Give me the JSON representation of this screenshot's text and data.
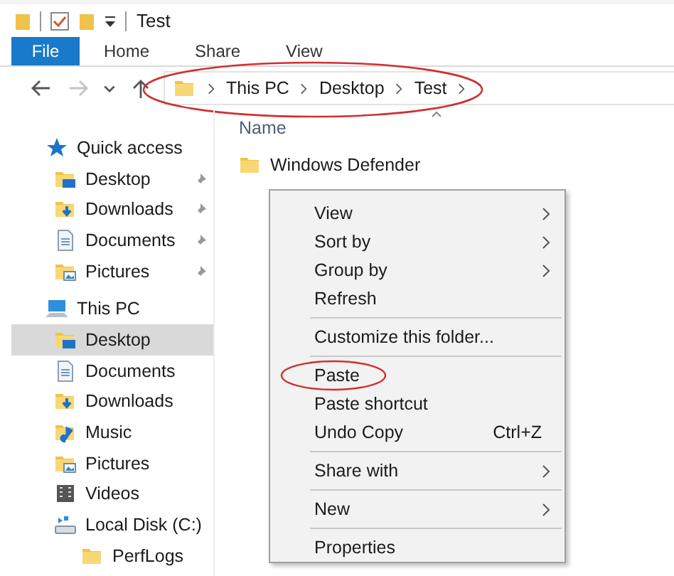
{
  "window": {
    "title": "Test"
  },
  "ribbon_tabs": [
    {
      "label": "File",
      "kind": "file"
    },
    {
      "label": "Home",
      "kind": "tab"
    },
    {
      "label": "Share",
      "kind": "tab"
    },
    {
      "label": "View",
      "kind": "tab"
    }
  ],
  "nav_buttons": [
    {
      "kind": "back",
      "disabled": false
    },
    {
      "kind": "forward",
      "disabled": true
    },
    {
      "kind": "recent",
      "disabled": false
    },
    {
      "kind": "up",
      "disabled": false
    }
  ],
  "address_bar": {
    "circled": true,
    "crumbs": [
      "This PC",
      "Desktop",
      "Test"
    ]
  },
  "sidebar": {
    "items": [
      {
        "label": "Quick access",
        "kind": "star",
        "selected": false,
        "children": [
          {
            "label": "Desktop",
            "kind": "desktop",
            "pinned": true,
            "selected": false
          },
          {
            "label": "Downloads",
            "kind": "downloads",
            "pinned": true,
            "selected": false
          },
          {
            "label": "Documents",
            "kind": "documents",
            "pinned": true,
            "selected": false
          },
          {
            "label": "Pictures",
            "kind": "pictures",
            "pinned": true,
            "selected": false
          }
        ]
      },
      {
        "label": "This PC",
        "kind": "pc",
        "selected": false,
        "children": [
          {
            "label": "Desktop",
            "kind": "desktop",
            "pinned": false,
            "selected": true
          },
          {
            "label": "Documents",
            "kind": "documents",
            "pinned": false,
            "selected": false
          },
          {
            "label": "Downloads",
            "kind": "downloads",
            "pinned": false,
            "selected": false
          },
          {
            "label": "Music",
            "kind": "music",
            "pinned": false,
            "selected": false
          },
          {
            "label": "Pictures",
            "kind": "pictures",
            "pinned": false,
            "selected": false
          },
          {
            "label": "Videos",
            "kind": "videos",
            "pinned": false,
            "selected": false
          },
          {
            "label": "Local Disk (C:)",
            "kind": "disk",
            "pinned": false,
            "selected": false,
            "children": [
              {
                "label": "PerfLogs",
                "kind": "folder",
                "pinned": false,
                "selected": false
              }
            ]
          }
        ]
      }
    ]
  },
  "file_list": {
    "columns": [
      "Name"
    ],
    "rows": [
      "Windows Defender"
    ]
  },
  "context_menu": {
    "groups": [
      [
        {
          "label": "View",
          "submenu": true,
          "circled": false
        },
        {
          "label": "Sort by",
          "submenu": true,
          "circled": false
        },
        {
          "label": "Group by",
          "submenu": true,
          "circled": false
        },
        {
          "label": "Refresh",
          "submenu": false,
          "circled": false
        }
      ],
      [
        {
          "label": "Customize this folder...",
          "submenu": false,
          "circled": false
        }
      ],
      [
        {
          "label": "Paste",
          "submenu": false,
          "circled": true
        },
        {
          "label": "Paste shortcut",
          "submenu": false,
          "circled": false
        },
        {
          "label": "Undo Copy",
          "submenu": false,
          "circled": false,
          "shortcut": "Ctrl+Z"
        }
      ],
      [
        {
          "label": "Share with",
          "submenu": true,
          "circled": false
        }
      ],
      [
        {
          "label": "New",
          "submenu": true,
          "circled": false
        }
      ],
      [
        {
          "label": "Properties",
          "submenu": false,
          "circled": false
        }
      ]
    ]
  }
}
